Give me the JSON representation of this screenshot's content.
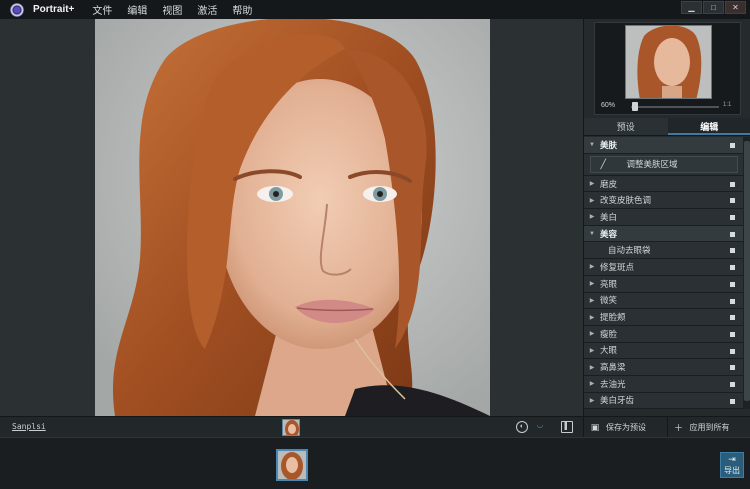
{
  "app": {
    "title": "Portrait+",
    "menu": [
      "文件",
      "编辑",
      "视图",
      "激活",
      "帮助"
    ]
  },
  "window_controls": [
    {
      "name": "minimize-icon",
      "glyph": "▁"
    },
    {
      "name": "maximize-icon",
      "glyph": "□"
    },
    {
      "name": "close-icon",
      "glyph": "✕"
    }
  ],
  "canvas": {
    "file_name": "Sanplsi"
  },
  "navigator": {
    "zoom_label": "60%",
    "zoom_fit": "1:1",
    "zoom_fraction": 0.05
  },
  "tabs": [
    {
      "label": "预设",
      "active": false
    },
    {
      "label": "编辑",
      "active": true
    }
  ],
  "sections": {
    "skin": {
      "title": "美肤",
      "action": "调整美肤区域",
      "items": [
        "磨皮",
        "改变皮肤色调",
        "美白"
      ]
    },
    "beauty": {
      "title": "美容",
      "plain_item": "自动去眼袋",
      "items": [
        "修复斑点",
        "亮眼",
        "微笑",
        "提脸颊",
        "瘦脸",
        "大眼",
        "高鼻梁",
        "去油光",
        "美白牙齿"
      ]
    }
  },
  "footer": {
    "save_preset": "保存为预设",
    "apply_all": "应用到所有"
  },
  "export": {
    "label": "导出"
  },
  "colors": {
    "accent": "#3e7ba3",
    "panel": "#252b2d",
    "canvas": "#2b3133"
  }
}
